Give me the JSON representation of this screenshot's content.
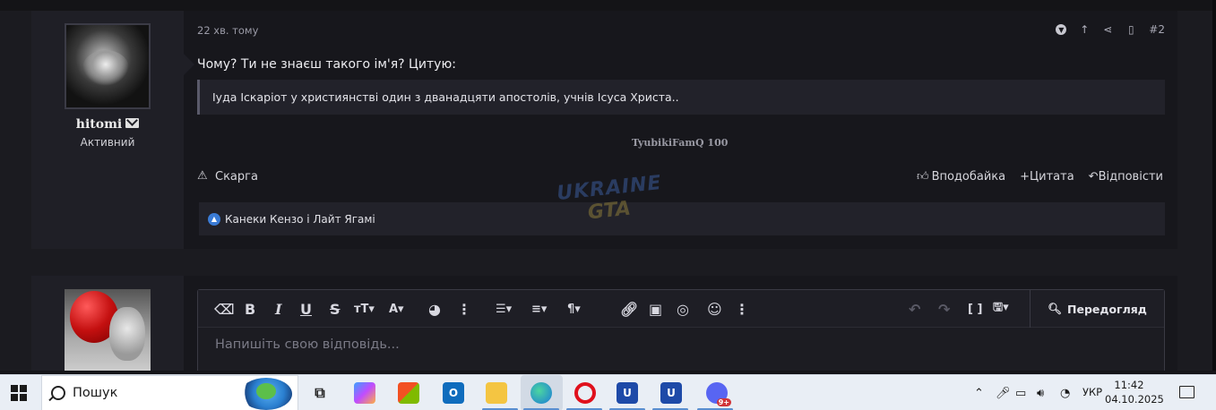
{
  "message": {
    "timestamp": "22 хв. тому",
    "post_number": "#2",
    "username": "hitomi",
    "user_title": "Активний",
    "body": "Чому? Ти не знаєш такого ім'я? Цитую:",
    "quote": "Іуда Іскаріот у християнстві один з дванадцяти апостолів, учнів Ісуса Христа..",
    "signature": "TyubikiFamQ 100",
    "complain_label": "Скарга",
    "actions": {
      "like": "Вподобайка",
      "quote": "Цитата",
      "reply": "Відповісти"
    },
    "likes_text": "Канеки Кензо і Лайт Ягамі"
  },
  "watermark": {
    "line1": "UKRAINE",
    "line2": "GTA"
  },
  "editor": {
    "placeholder": "Напишіть свою відповідь...",
    "preview_label": "Передогляд"
  },
  "taskbar": {
    "search_label": "Пошук",
    "language": "УКР",
    "time": "11:42",
    "date": "04.10.2025",
    "discord_badge": "9+"
  },
  "icons": [
    "windows-start-icon",
    "search-icon",
    "task-view-icon",
    "copilot-icon",
    "store-icon",
    "outlook-icon",
    "file-explorer-icon",
    "edge-icon",
    "opera-icon",
    "game-launcher-icon",
    "discord-icon",
    "chevron-up-icon",
    "microphone-icon",
    "battery-icon",
    "speaker-icon",
    "wifi-icon",
    "notification-icon"
  ],
  "colors": {
    "page_bg": "#1b1b20",
    "card_bg": "#17171c",
    "user_col_bg": "#1f1f26",
    "like_blue": "#3a7bd5",
    "taskbar_bg": "#e9eef5"
  }
}
